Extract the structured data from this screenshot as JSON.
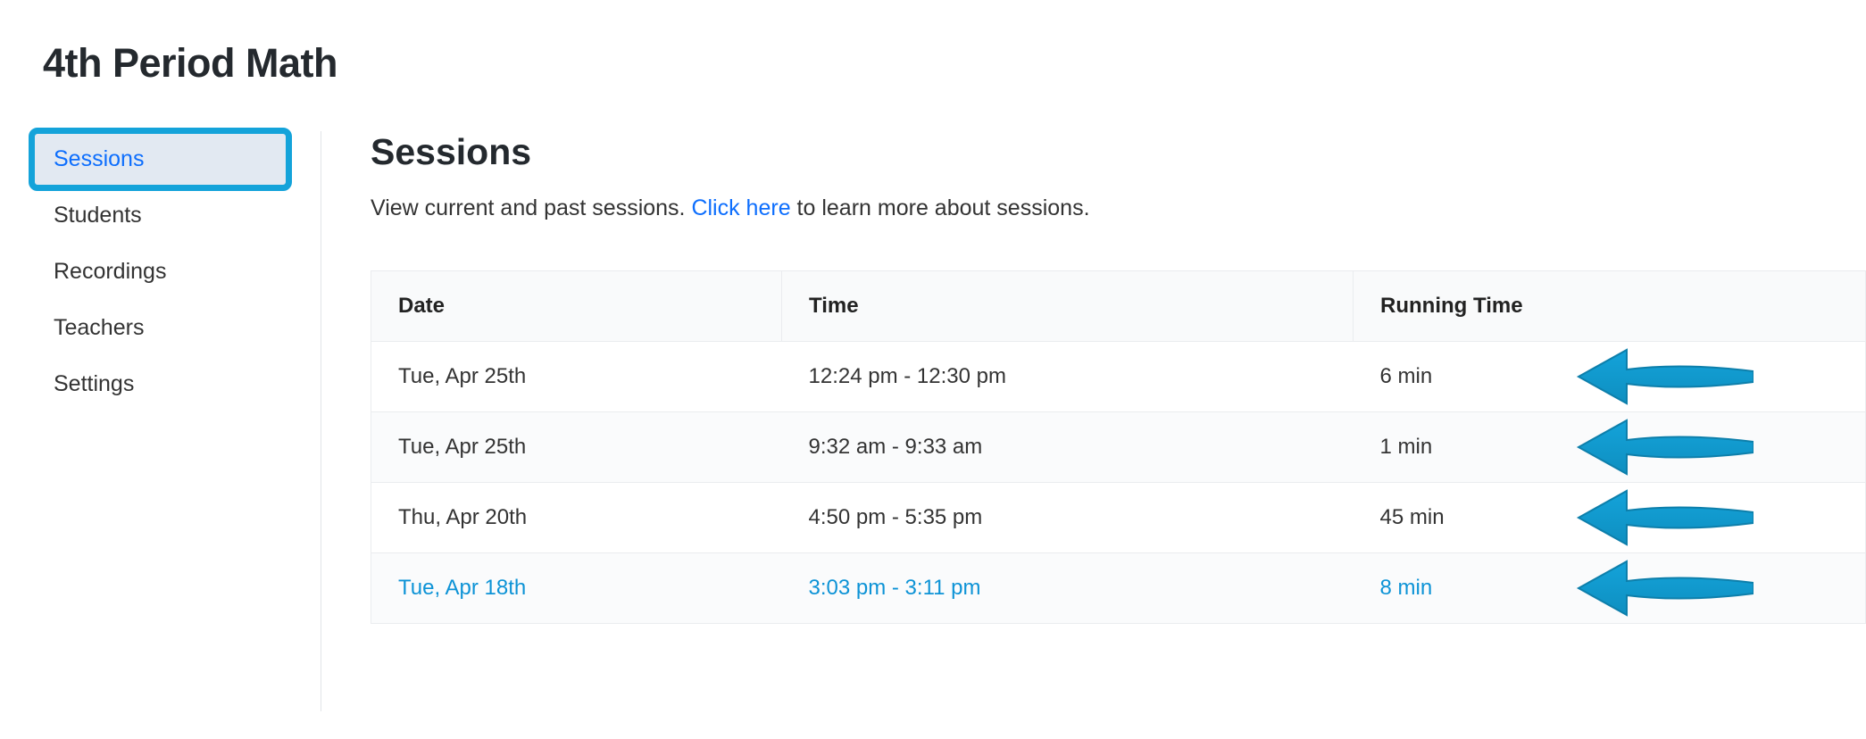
{
  "pageTitle": "4th Period Math",
  "sidebar": {
    "items": [
      {
        "label": "Sessions",
        "active": true
      },
      {
        "label": "Students",
        "active": false
      },
      {
        "label": "Recordings",
        "active": false
      },
      {
        "label": "Teachers",
        "active": false
      },
      {
        "label": "Settings",
        "active": false
      }
    ]
  },
  "section": {
    "title": "Sessions",
    "desc_pre": "View current and past sessions. ",
    "desc_link": "Click here",
    "desc_post": " to learn more about sessions."
  },
  "table": {
    "headers": {
      "date": "Date",
      "time": "Time",
      "running": "Running Time"
    },
    "rows": [
      {
        "date": "Tue, Apr 25th",
        "time": "12:24 pm - 12:30 pm",
        "running": "6 min",
        "hover": false
      },
      {
        "date": "Tue, Apr 25th",
        "time": "9:32 am - 9:33 am",
        "running": "1 min",
        "hover": false
      },
      {
        "date": "Thu, Apr 20th",
        "time": "4:50 pm - 5:35 pm",
        "running": "45 min",
        "hover": false
      },
      {
        "date": "Tue, Apr 18th",
        "time": "3:03 pm - 3:11 pm",
        "running": "8 min",
        "hover": true
      }
    ]
  },
  "colors": {
    "highlight": "#14a3da",
    "link": "#0d6efd",
    "arrow": "#14a3da"
  }
}
